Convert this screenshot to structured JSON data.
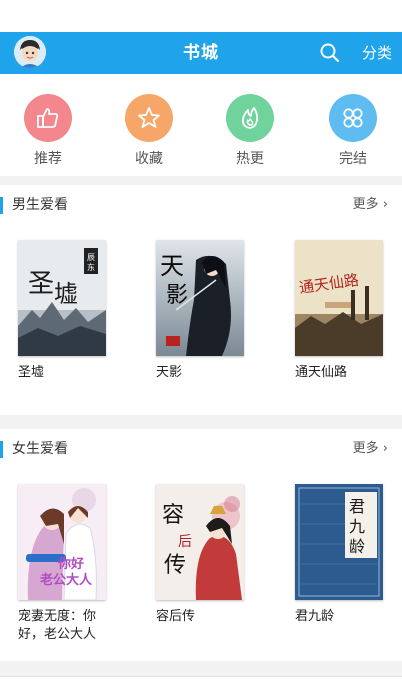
{
  "header": {
    "title": "书城",
    "category_label": "分类",
    "avatar_icon": "user-avatar-icon",
    "search_icon": "search-icon",
    "bg_color": "#1fa3ea"
  },
  "quick_menu": [
    {
      "label": "推荐",
      "icon": "thumbs-up-icon",
      "color": "#f4868d"
    },
    {
      "label": "收藏",
      "icon": "star-icon",
      "color": "#f7a66a"
    },
    {
      "label": "热更",
      "icon": "flame-icon",
      "color": "#6fd39b"
    },
    {
      "label": "完结",
      "icon": "grid-icon",
      "color": "#5ebcf1"
    }
  ],
  "sections": [
    {
      "title": "男生爱看",
      "more_label": "更多",
      "books": [
        {
          "title": "圣墟",
          "cover_text": "圣墟"
        },
        {
          "title": "天影",
          "cover_text": "天影"
        },
        {
          "title": "通天仙路",
          "cover_text": "通天仙路"
        }
      ]
    },
    {
      "title": "女生爱看",
      "more_label": "更多",
      "books": [
        {
          "title": "宠妻无度：你好，老公大人",
          "cover_text": "你好老公大人"
        },
        {
          "title": "容后传",
          "cover_text": "容后传"
        },
        {
          "title": "君九龄",
          "cover_text": "君九龄"
        }
      ]
    }
  ]
}
